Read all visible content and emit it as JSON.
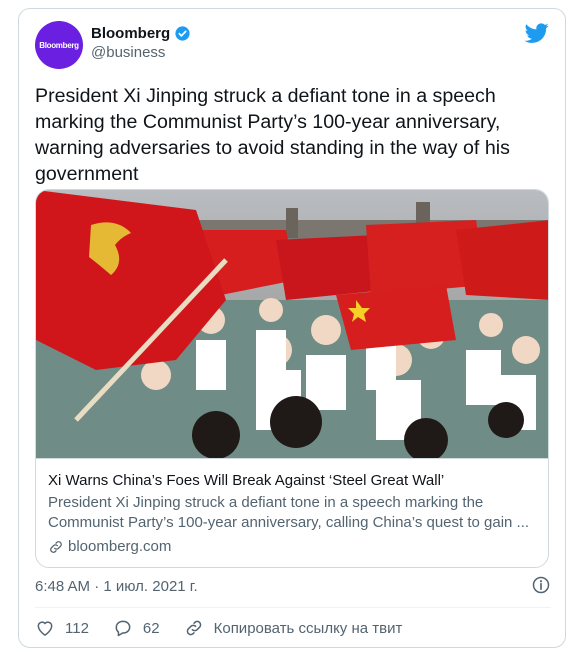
{
  "account": {
    "avatar_text": "Bloomberg",
    "display_name": "Bloomberg",
    "handle": "@business"
  },
  "tweet": {
    "text": "President Xi Jinping struck a defiant tone in a speech marking the Communist Party’s 100-year anniversary, warning adversaries to avoid standing in the way of his government"
  },
  "card": {
    "title": "Xi Warns China’s Foes Will Break Against ‘Steel Great Wall’",
    "description": "President Xi Jinping struck a defiant tone in a speech marking the Communist Party’s 100-year anniversary, calling China’s quest to gain ...",
    "domain": "bloomberg.com"
  },
  "meta": {
    "timestamp": "6:48 AM · 1 июл. 2021 г."
  },
  "actions": {
    "likes": "112",
    "replies": "62",
    "copy_link": "Копировать ссылку на твит"
  },
  "colors": {
    "avatar_bg": "#6a1fe1",
    "twitter_blue": "#1d9bf0",
    "secondary_text": "#536471"
  },
  "icons": [
    "verified-icon",
    "twitter-logo-icon",
    "link-icon",
    "info-icon",
    "heart-icon",
    "reply-icon",
    "copy-link-icon"
  ]
}
